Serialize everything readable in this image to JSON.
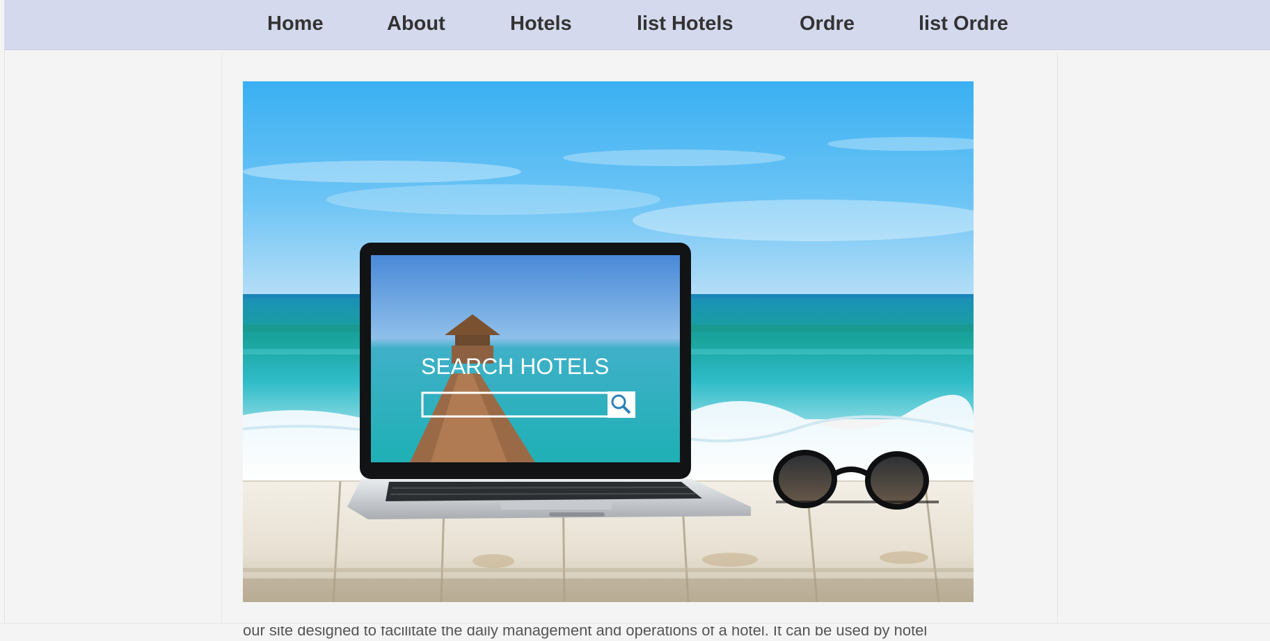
{
  "nav": {
    "items": [
      {
        "label": "Home"
      },
      {
        "label": "About"
      },
      {
        "label": "Hotels"
      },
      {
        "label": "list Hotels"
      },
      {
        "label": "Ordre"
      },
      {
        "label": "list Ordre"
      }
    ]
  },
  "hero": {
    "screen_heading": "SEARCH HOTELS",
    "icons": [
      "search-icon"
    ]
  },
  "main": {
    "description": "our site designed to facilitate the daily management and operations of a hotel. It can be used by hotel"
  },
  "colors": {
    "navbar_bg": "#d5d9ed",
    "nav_text": "#333333",
    "page_bg": "#f4f4f4",
    "body_text": "#555555"
  }
}
